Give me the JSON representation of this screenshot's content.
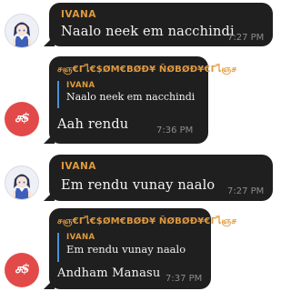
{
  "messages": [
    {
      "sender": "IVANA",
      "text": "Naalo neek em nacchindi",
      "time": "7:27 PM"
    },
    {
      "sender": "சஞ€Γไ€ SOM€BØÐ¥ ÑØBØÐ¥ €Γไச",
      "reply": {
        "sender": "IVANA",
        "text": "Naalo neek em nacchindi"
      },
      "text": "Aah rendu",
      "time": "7:36 PM"
    },
    {
      "sender": "IVANA",
      "text": "Em rendu vunay naalo",
      "time": "7:27 PM"
    },
    {
      "sender": "சஞ€Γไ€ SOM€BØÐ¥ ÑØBØÐ¥ €Γไச",
      "reply": {
        "sender": "IVANA",
        "text": "Em rendu vunay naalo"
      },
      "text": "Andham Manasu",
      "time": "7:37 PM"
    }
  ],
  "display_names": {
    "ivana": "IVANA",
    "somebody": "சஞ€Γไ€$ØM€BØÐ¥ ÑØBØÐ¥€Γไஞச",
    "somebody_logo": "ச$"
  },
  "colors": {
    "bubble": "#1f1f1f",
    "sender_name": "#e09a3f",
    "quote_bar": "#4a90d9",
    "time": "#8c8c8c",
    "red_avatar": "#e24a4a"
  },
  "icons": {
    "ivana_avatar": "anime-girl-avatar",
    "somebody_avatar": "red-logo-avatar"
  }
}
